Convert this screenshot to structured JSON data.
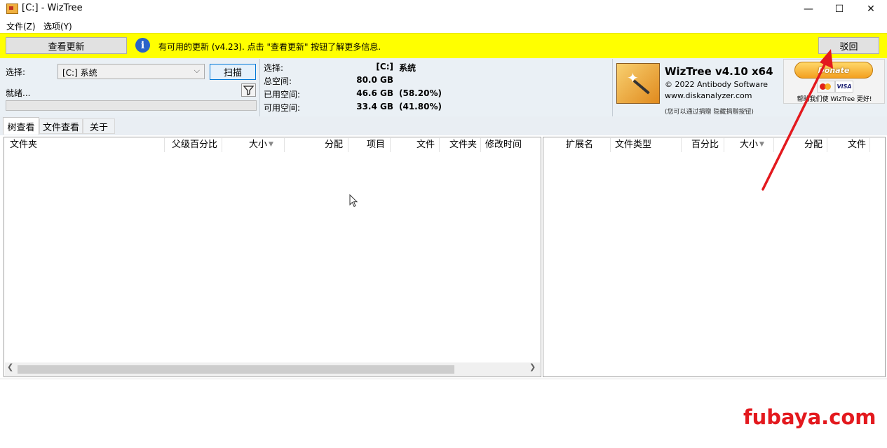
{
  "window": {
    "title": "[C:]  - WizTree",
    "minimize": "—",
    "maximize": "☐",
    "close": "✕"
  },
  "menu": [
    "文件(Z)",
    "选项(Y)"
  ],
  "update_bar": {
    "check_button": "查看更新",
    "message": "有可用的更新 (v4.23). 点击 \"查看更新\" 按钮了解更多信息.",
    "dismiss_button": "驳回",
    "background": "#ffff00"
  },
  "controls": {
    "select_label": "选择:",
    "drive_value": "[C:] 系统",
    "scan_button": "扫描",
    "status": "就绪..."
  },
  "stats": {
    "select_label": "选择:",
    "select_drive": "[C:]",
    "select_name": "系统",
    "total_label": "总空间:",
    "total_value": "80.0 GB",
    "used_label": "已用空间:",
    "used_value": "46.6 GB",
    "used_pct": "(58.20%)",
    "free_label": "可用空间:",
    "free_value": "33.4 GB",
    "free_pct": "(41.80%)"
  },
  "about": {
    "app_name": "WizTree v4.10 x64",
    "copyright": "© 2022 Antibody Software",
    "website": "www.diskanalyzer.com",
    "donate_note": "(您可以通过捐赠 隐藏捐赠按钮)",
    "donate_button": "Donate",
    "visa": "VISA",
    "donate_help": "帮助我们使 WizTree 更好!"
  },
  "tabs": [
    "树查看",
    "文件查看",
    "关于"
  ],
  "left_columns": [
    "文件夹",
    "父级百分比",
    "大小",
    "分配",
    "项目",
    "文件",
    "文件夹",
    "修改时间"
  ],
  "right_columns": [
    "扩展名",
    "文件类型",
    "百分比",
    "大小",
    "分配",
    "文件"
  ],
  "watermark": "fubaya.com"
}
